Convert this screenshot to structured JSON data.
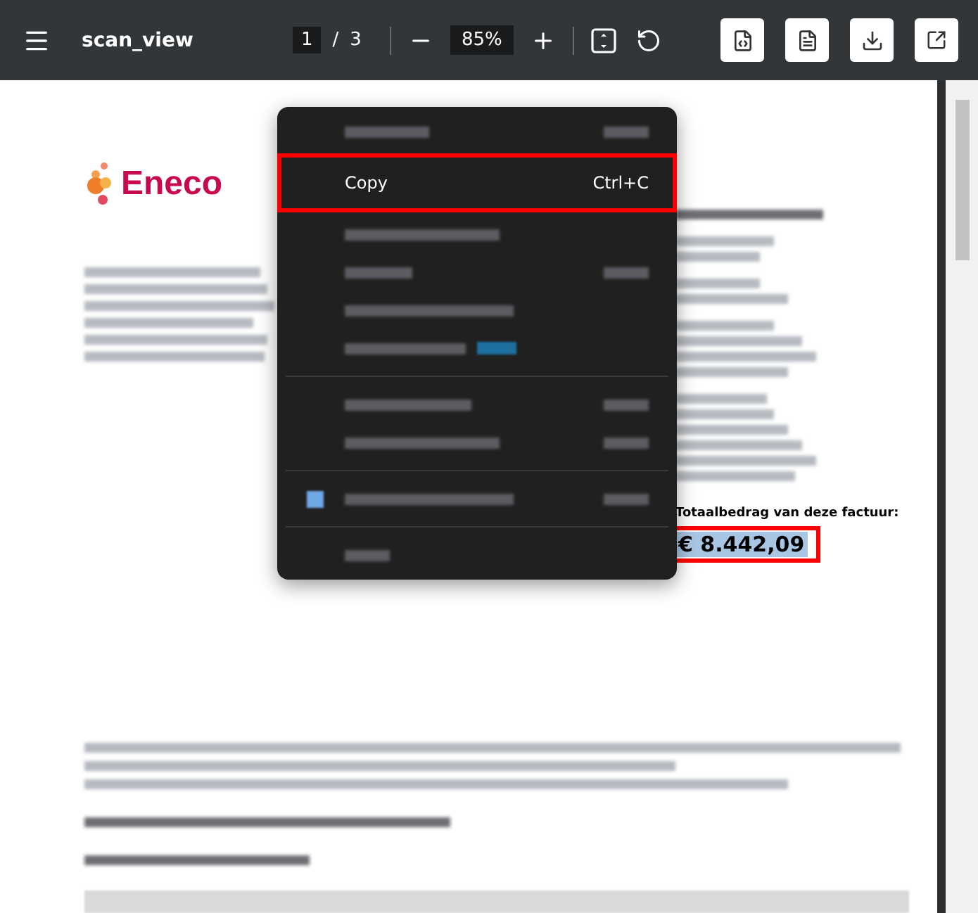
{
  "toolbar": {
    "title": "scan_view",
    "page_current": "1",
    "page_separator": "/",
    "page_total": "3",
    "zoom": "85%"
  },
  "context_menu": {
    "items": [
      {
        "kind": "redacted",
        "shortcut": true
      },
      {
        "kind": "item",
        "label": "Copy",
        "shortcut_text": "Ctrl+C",
        "outlined": true
      },
      {
        "kind": "redacted",
        "shortcut": false
      },
      {
        "kind": "redacted",
        "shortcut": true
      },
      {
        "kind": "redacted",
        "shortcut": false
      },
      {
        "kind": "redacted",
        "shortcut": false,
        "badge": true
      },
      {
        "kind": "separator"
      },
      {
        "kind": "redacted",
        "shortcut": true
      },
      {
        "kind": "redacted",
        "shortcut": true
      },
      {
        "kind": "separator"
      },
      {
        "kind": "redacted",
        "shortcut": true,
        "icon": true
      },
      {
        "kind": "separator"
      },
      {
        "kind": "redacted",
        "shortcut": false
      }
    ]
  },
  "document": {
    "logo_text": "Eneco",
    "total_label": "Totaalbedrag van deze factuur:",
    "total_amount": "€ 8.442,09",
    "total_selected": true,
    "total_outlined": true
  }
}
